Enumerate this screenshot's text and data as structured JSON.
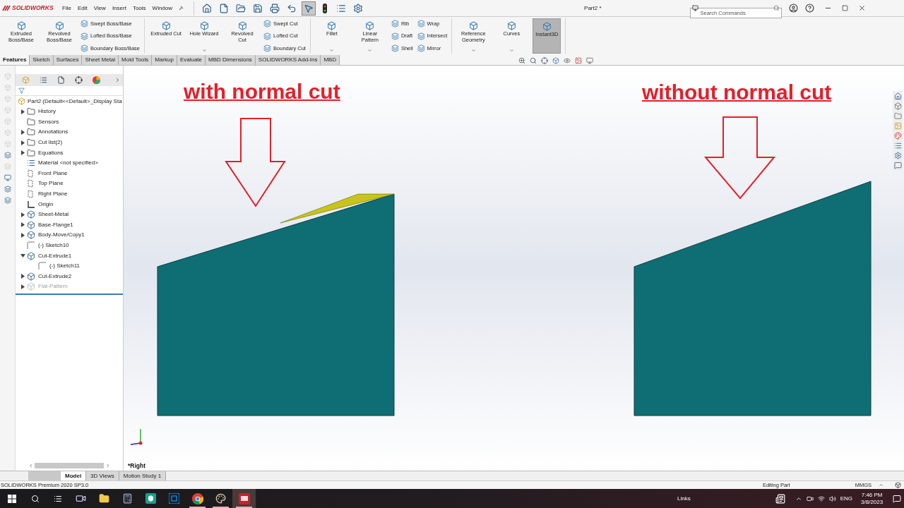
{
  "title_bar": {
    "app_name": "SOLIDWORKS",
    "menu": [
      "File",
      "Edit",
      "View",
      "Insert",
      "Tools",
      "Window"
    ],
    "quick_access": [
      {
        "kind": "home",
        "selected": false
      },
      {
        "kind": "new",
        "selected": false
      },
      {
        "kind": "open",
        "selected": false
      },
      {
        "kind": "save",
        "selected": false
      },
      {
        "kind": "print",
        "selected": false
      },
      {
        "kind": "undo",
        "selected": false
      },
      {
        "kind": "select",
        "selected": true
      },
      {
        "kind": "rebuild",
        "selected": false
      },
      {
        "kind": "properties",
        "selected": false
      },
      {
        "kind": "options",
        "selected": false
      }
    ],
    "document_title": "Part2 *",
    "search": {
      "placeholder": "Search Commands"
    }
  },
  "ribbon": [
    [
      {
        "kind": "large",
        "label": "Extruded Boss/Base",
        "dropdown": false,
        "selected": false
      },
      {
        "kind": "large",
        "label": "Revolved Boss/Base",
        "dropdown": false,
        "selected": false
      },
      {
        "kind": "stack",
        "items": [
          "Swept Boss/Base",
          "Lofted Boss/Base",
          "Boundary Boss/Base"
        ]
      }
    ],
    [
      {
        "kind": "large",
        "label": "Extruded Cut",
        "dropdown": false,
        "selected": false
      },
      {
        "kind": "large",
        "label": "Hole Wizard",
        "dropdown": true,
        "selected": false
      },
      {
        "kind": "large",
        "label": "Revolved Cut",
        "dropdown": false,
        "selected": false
      },
      {
        "kind": "stack",
        "items": [
          "Swept Cut",
          "Lofted Cut",
          "Boundary Cut"
        ]
      }
    ],
    [
      {
        "kind": "large",
        "label": "Fillet",
        "dropdown": true,
        "selected": false
      },
      {
        "kind": "large",
        "label": "Linear Pattern",
        "dropdown": true,
        "selected": false
      },
      {
        "kind": "stack",
        "items": [
          "Rib",
          "Draft",
          "Shell"
        ]
      },
      {
        "kind": "stack",
        "items": [
          "Wrap",
          "Intersect",
          "Mirror"
        ]
      }
    ],
    [
      {
        "kind": "large",
        "label": "Reference Geometry",
        "dropdown": true,
        "selected": false
      },
      {
        "kind": "large",
        "label": "Curves",
        "dropdown": true,
        "selected": false
      },
      {
        "kind": "large",
        "label": "Instant3D",
        "dropdown": false,
        "selected": true
      }
    ]
  ],
  "command_tabs": [
    {
      "label": "Features",
      "selected": true
    },
    {
      "label": "Sketch",
      "selected": false
    },
    {
      "label": "Surfaces",
      "selected": false
    },
    {
      "label": "Sheet Metal",
      "selected": false
    },
    {
      "label": "Mold Tools",
      "selected": false
    },
    {
      "label": "Markup",
      "selected": false
    },
    {
      "label": "Evaluate",
      "selected": false
    },
    {
      "label": "MBD Dimensions",
      "selected": false
    },
    {
      "label": "SOLIDWORKS Add-Ins",
      "selected": false
    },
    {
      "label": "MBD",
      "selected": false
    }
  ],
  "feature_tree": {
    "root": "Part2  (Default<<Default>_Display Sta",
    "items": [
      {
        "label": "History",
        "kind": "folder",
        "expandable": true,
        "expanded": false,
        "disabled": false
      },
      {
        "label": "Sensors",
        "kind": "folder",
        "expandable": false,
        "disabled": false
      },
      {
        "label": "Annotations",
        "kind": "folder",
        "expandable": true,
        "expanded": false,
        "disabled": false
      },
      {
        "label": "Cut list(2)",
        "kind": "folder",
        "expandable": true,
        "expanded": false,
        "disabled": false
      },
      {
        "label": "Equations",
        "kind": "folder",
        "expandable": true,
        "expanded": false,
        "disabled": false
      },
      {
        "label": "Material <not specified>",
        "kind": "material",
        "expandable": false,
        "disabled": false
      },
      {
        "label": "Front Plane",
        "kind": "plane",
        "expandable": false,
        "disabled": false
      },
      {
        "label": "Top Plane",
        "kind": "plane",
        "expandable": false,
        "disabled": false
      },
      {
        "label": "Right Plane",
        "kind": "plane",
        "expandable": false,
        "disabled": false
      },
      {
        "label": "Origin",
        "kind": "origin",
        "expandable": false,
        "disabled": false
      },
      {
        "label": "Sheet-Metal",
        "kind": "feature",
        "expandable": true,
        "expanded": false,
        "disabled": false
      },
      {
        "label": "Base-Flange1",
        "kind": "feature",
        "expandable": true,
        "expanded": false,
        "disabled": false
      },
      {
        "label": "Body-Move/Copy1",
        "kind": "feature",
        "expandable": true,
        "expanded": false,
        "disabled": false
      },
      {
        "label": "(-) Sketch10",
        "kind": "sketch",
        "expandable": false,
        "disabled": false
      },
      {
        "label": "Cut-Extrude1",
        "kind": "feature",
        "expandable": true,
        "expanded": true,
        "disabled": false,
        "children": [
          {
            "label": "(-) Sketch11",
            "kind": "sketch",
            "expandable": false,
            "disabled": false
          }
        ]
      },
      {
        "label": "Cut-Extrude2",
        "kind": "feature",
        "expandable": true,
        "expanded": false,
        "disabled": false
      },
      {
        "label": "Flat-Pattern",
        "kind": "feature",
        "expandable": true,
        "expanded": false,
        "disabled": true
      }
    ]
  },
  "viewport": {
    "headings": [
      "with normal cut",
      "without normal cut"
    ],
    "view_name": "*Right"
  },
  "bottom_tabs": [
    {
      "label": "Model",
      "selected": true
    },
    {
      "label": "3D Views",
      "selected": false
    },
    {
      "label": "Motion Study 1",
      "selected": false
    }
  ],
  "status_bar": {
    "product": "SOLIDWORKS Premium 2020 SP3.0",
    "mode": "Editing Part",
    "units": "MMGS"
  },
  "taskbar": {
    "apps": [
      {
        "kind": "media",
        "running": false,
        "selected": false
      },
      {
        "kind": "explorer",
        "running": false,
        "selected": false
      },
      {
        "kind": "calculator",
        "running": false,
        "selected": false
      },
      {
        "kind": "viewer",
        "running": false,
        "selected": false
      },
      {
        "kind": "photoshop",
        "running": false,
        "selected": false
      },
      {
        "kind": "chrome",
        "running": true,
        "selected": false
      },
      {
        "kind": "paint",
        "running": true,
        "selected": false
      },
      {
        "kind": "solidworks",
        "running": true,
        "selected": true
      }
    ],
    "links": "Links",
    "language": "ENG",
    "time": "7:46 PM",
    "date": "3/8/2023"
  }
}
